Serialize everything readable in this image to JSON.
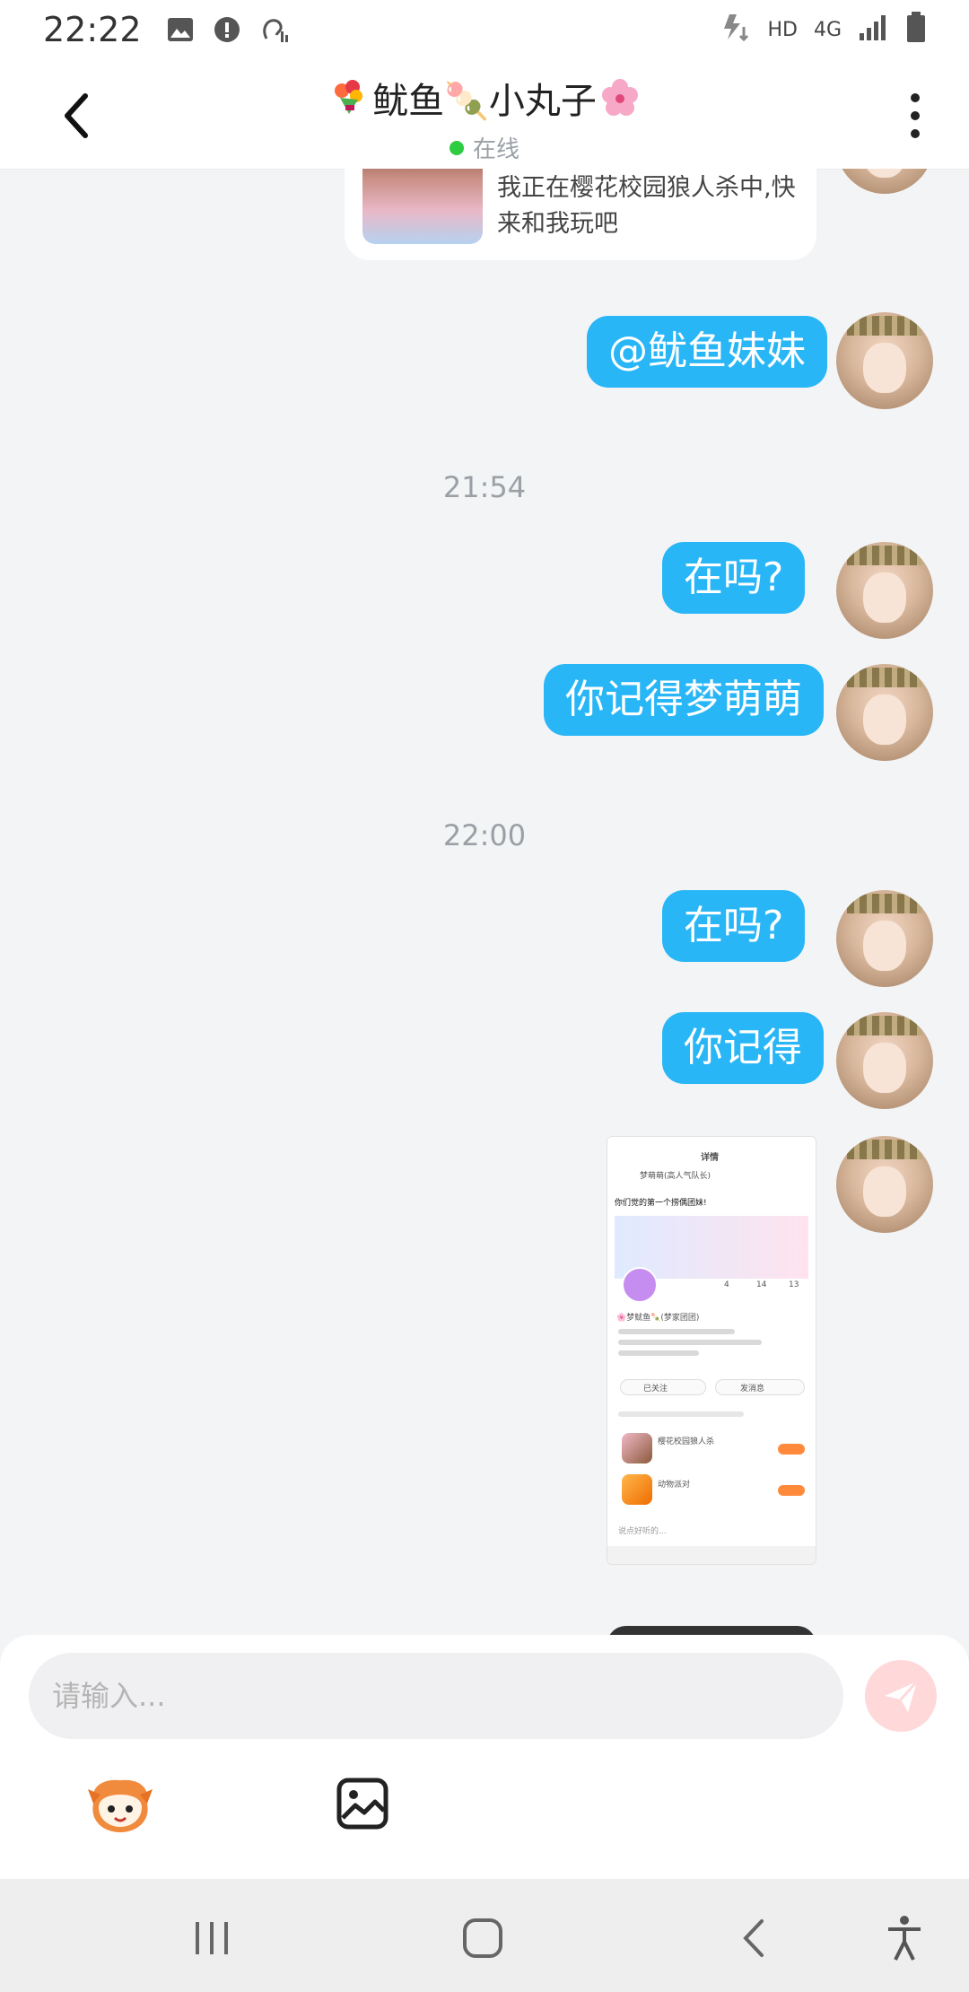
{
  "status_bar": {
    "time": "22:22",
    "network_label": "HD",
    "signal_label": "4G"
  },
  "header": {
    "title": "鱿鱼🍡小丸子",
    "status": "在线"
  },
  "messages": {
    "card_text": "我正在樱花校园狼人杀中,快来和我玩吧",
    "mention": "@鱿鱼妹妹",
    "time1": "21:54",
    "m1": "在吗?",
    "m2": "你记得梦萌萌",
    "time2": "22:00",
    "m3": "在吗?",
    "m4": "你记得"
  },
  "screenshot_thumb": {
    "title": "详情",
    "user": "梦萌萌(高人气队长)",
    "caption": "你们觉的第一个捞偶团妹!",
    "name": "🌸梦鱿鱼🍡(梦家团团)",
    "stats": [
      "4",
      "14",
      "13"
    ],
    "follow": "已关注",
    "chat": "发消息",
    "game1": "樱花校园狼人杀",
    "game2": "动物派对",
    "input": "说点好听的..."
  },
  "input": {
    "placeholder": "请输入..."
  },
  "colors": {
    "bubble": "#29b6f6",
    "send": "#ffd8da",
    "online": "#2ecc40"
  },
  "icons": [
    "back-icon",
    "more-icon",
    "send-icon",
    "emoji-mascot-icon",
    "image-icon",
    "recents-icon",
    "home-icon",
    "nav-back-icon",
    "accessibility-icon"
  ]
}
